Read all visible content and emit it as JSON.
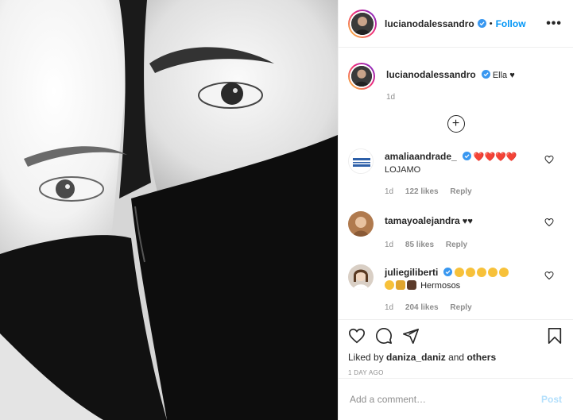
{
  "post": {
    "author": "lucianodalessandro",
    "follow_label": "Follow",
    "separator": "•",
    "more_label": "•••"
  },
  "caption": {
    "author": "lucianodalessandro",
    "text": "Ella ♥",
    "time": "1d"
  },
  "load_more_label": "+",
  "comments": [
    {
      "author": "amaliaandrade_",
      "text": "LOJAMO",
      "time": "1d",
      "likes": "122 likes",
      "reply": "Reply",
      "emoji": "❤️❤️❤️❤️"
    },
    {
      "author": "tamayoalejandra",
      "text": "♥♥",
      "time": "1d",
      "likes": "85 likes",
      "reply": "Reply"
    },
    {
      "author": "juliegiliberti",
      "text": "Hermosos",
      "time": "1d",
      "likes": "204 likes",
      "reply": "Reply"
    }
  ],
  "actions": {
    "liked_by_prefix": "Liked by",
    "liked_by_user": "daniza_daniz",
    "liked_by_and": "and",
    "liked_by_others": "others",
    "time_ago": "1 DAY AGO"
  },
  "add_comment": {
    "placeholder": "Add a comment…",
    "post_label": "Post"
  },
  "colors": {
    "link_blue": "#0095f6",
    "post_disabled": "#b2dffc",
    "verified_blue": "#3897f0",
    "heart_red": "#ed4956"
  }
}
